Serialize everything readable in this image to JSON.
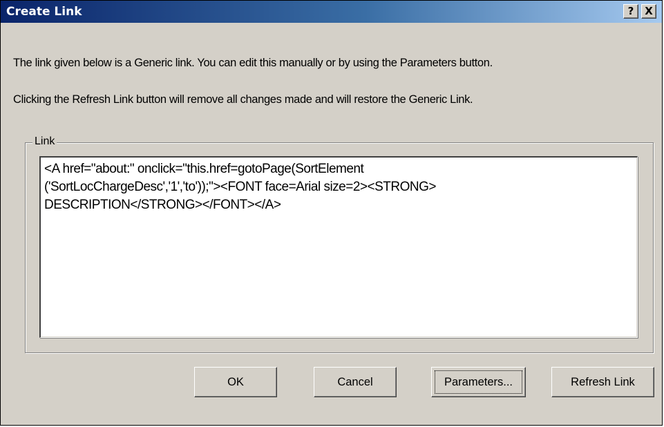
{
  "window": {
    "title": "Create Link",
    "help_label": "?",
    "close_label": "X"
  },
  "description": {
    "line1": "The link given below is a Generic link. You can edit this manually or by using the Parameters button.",
    "line2": "Clicking the Refresh Link button will remove all changes made and will restore the Generic Link."
  },
  "link_group": {
    "label": "Link",
    "value": "<A href=\"about:\" onclick=\"this.href=gotoPage(SortElement\n('SortLocChargeDesc','1','to'));\"><FONT face=Arial size=2><STRONG>\nDESCRIPTION</STRONG></FONT></A>"
  },
  "buttons": {
    "ok": "OK",
    "cancel": "Cancel",
    "parameters": "Parameters...",
    "refresh": "Refresh Link"
  },
  "colors": {
    "titlebar_start": "#0a246a",
    "titlebar_end": "#a6caf0",
    "dialog_background": "#d4d0c8"
  }
}
